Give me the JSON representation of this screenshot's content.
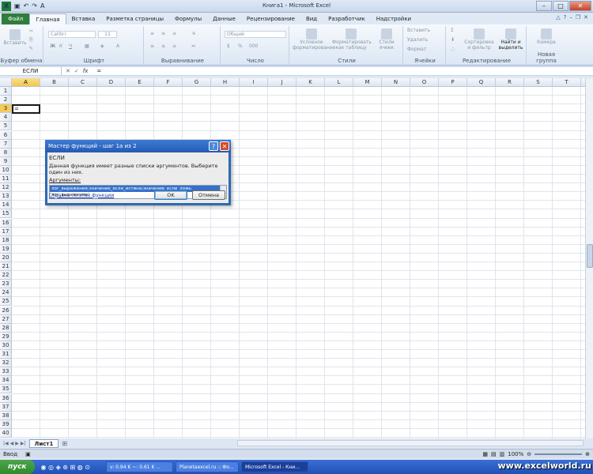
{
  "window": {
    "title": "Книга1  -  Microsoft Excel"
  },
  "qat": {
    "logo": "X",
    "icons": [
      "save-icon",
      "undo-icon",
      "redo-icon",
      "font-icon"
    ]
  },
  "tabs": [
    {
      "label": "Файл"
    },
    {
      "label": "Главная"
    },
    {
      "label": "Вставка"
    },
    {
      "label": "Разметка страницы"
    },
    {
      "label": "Формулы"
    },
    {
      "label": "Данные"
    },
    {
      "label": "Рецензирование"
    },
    {
      "label": "Вид"
    },
    {
      "label": "Разработчик"
    },
    {
      "label": "Надстройки"
    }
  ],
  "ribbon": {
    "groups": [
      {
        "label": "Буфер обмена",
        "button": "Вставить"
      },
      {
        "label": "Шрифт",
        "font": "Calibri",
        "size": "11"
      },
      {
        "label": "Выравнивание"
      },
      {
        "label": "Число",
        "format": "Общий"
      },
      {
        "label": "Стили",
        "buttons": [
          "Условное форматирование",
          "Форматировать как таблицу",
          "Стили ячеек"
        ]
      },
      {
        "label": "Ячейки",
        "buttons": [
          "Вставить",
          "Удалить",
          "Формат"
        ]
      },
      {
        "label": "Редактирование",
        "buttons": [
          "Сортировка и фильтр",
          "Найти и выделить"
        ]
      },
      {
        "label": "Новая группа",
        "button": "Камера"
      }
    ]
  },
  "formula_bar": {
    "name_box": "ЕСЛИ",
    "fx_label": "fx",
    "formula": "="
  },
  "grid": {
    "columns": [
      "A",
      "B",
      "C",
      "D",
      "E",
      "F",
      "G",
      "H",
      "I",
      "J",
      "K",
      "L",
      "M",
      "N",
      "O",
      "P",
      "Q",
      "R",
      "S",
      "T",
      "U"
    ],
    "rows": [
      "1",
      "2",
      "3",
      "4",
      "5",
      "6",
      "7",
      "8",
      "9",
      "10",
      "11",
      "12",
      "13",
      "14",
      "15",
      "16",
      "17",
      "18",
      "19",
      "20",
      "21",
      "22",
      "23",
      "24",
      "25",
      "26",
      "27",
      "28",
      "29",
      "30",
      "31",
      "32",
      "33",
      "34",
      "35",
      "36",
      "37",
      "38",
      "39",
      "40"
    ],
    "active_cell": "A3",
    "active_value": "="
  },
  "dialog": {
    "title": "Мастер функций - шаг 1а из 2",
    "function_name": "ЕСЛИ",
    "description": "Данная функция имеет разные списки аргументов. Выберите один из них.",
    "args_label": "Аргументы:",
    "options": [
      "лог_выражение;значение_если_истина;значение_если_ложь",
      "лог_выражение"
    ],
    "help_link": "Справка по этой функции",
    "ok": "OK",
    "cancel": "Отмена"
  },
  "sheets": {
    "tab": "Лист1"
  },
  "status": {
    "ready": "Ввод",
    "zoom": "100%"
  },
  "taskbar": {
    "start": "пуск",
    "apps": [
      "v: 0.94 K ~: 0.61 K ...",
      "Planetaexcel.ru :: Фо...",
      "Microsoft Excel - Кни..."
    ],
    "watermark": "www.excelworld.ru"
  }
}
